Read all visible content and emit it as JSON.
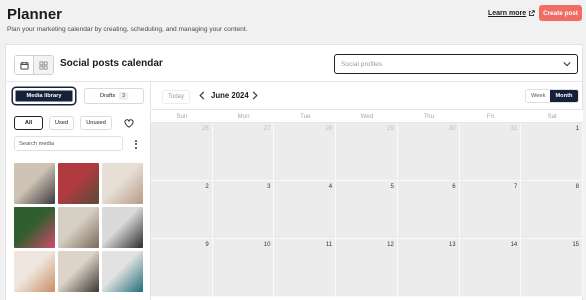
{
  "header": {
    "title": "Planner",
    "subtitle": "Plan your marketing calendar by creating, scheduling, and managing your content.",
    "learn_more": "Learn more",
    "create_post": "Create post"
  },
  "toolbar": {
    "calendar_title": "Social posts calendar",
    "profiles_placeholder": "Social profiles"
  },
  "media_panel": {
    "tab_media": "Media library",
    "tab_drafts": "Drafts",
    "drafts_count": "3",
    "filters": {
      "all": "All",
      "used": "Used",
      "unused": "Unused"
    },
    "search_placeholder": "Search media",
    "thumbnails": [
      {
        "name": "thumb-woman-laptop",
        "c1": "#cfc3b6",
        "c2": "#3a3a3a"
      },
      {
        "name": "thumb-red-hat",
        "c1": "#b13a3f",
        "c2": "#5a4a3a"
      },
      {
        "name": "thumb-coffee-flatlay",
        "c1": "#e7dfd6",
        "c2": "#b89a85"
      },
      {
        "name": "thumb-hand-flower",
        "c1": "#2f5f2f",
        "c2": "#d24a6a"
      },
      {
        "name": "thumb-dried-bouquet",
        "c1": "#d6cfc4",
        "c2": "#7b6b58"
      },
      {
        "name": "thumb-black-white-sea",
        "c1": "#dadada",
        "c2": "#2b2b2b"
      },
      {
        "name": "thumb-bottle-shelf",
        "c1": "#efe7df",
        "c2": "#c98d63"
      },
      {
        "name": "thumb-person-walking",
        "c1": "#ddd3c8",
        "c2": "#3a3632"
      },
      {
        "name": "thumb-teal-bag",
        "c1": "#e2e2e2",
        "c2": "#1f6f7a"
      }
    ]
  },
  "calendar": {
    "today": "Today",
    "month_label": "June 2024",
    "view_week": "Week",
    "view_month": "Month",
    "weekdays": [
      "Sun",
      "Mon",
      "Tue",
      "Wed",
      "Thu",
      "Fri",
      "Sat"
    ],
    "weeks": [
      [
        {
          "d": "26",
          "other": true
        },
        {
          "d": "27",
          "other": true
        },
        {
          "d": "28",
          "other": true
        },
        {
          "d": "29",
          "other": true
        },
        {
          "d": "30",
          "other": true
        },
        {
          "d": "31",
          "other": true
        },
        {
          "d": "1",
          "other": false
        }
      ],
      [
        {
          "d": "2",
          "other": false
        },
        {
          "d": "3",
          "other": false
        },
        {
          "d": "4",
          "other": false
        },
        {
          "d": "5",
          "other": false
        },
        {
          "d": "6",
          "other": false
        },
        {
          "d": "7",
          "other": false
        },
        {
          "d": "8",
          "other": false
        }
      ],
      [
        {
          "d": "9",
          "other": false
        },
        {
          "d": "10",
          "other": false
        },
        {
          "d": "11",
          "other": false
        },
        {
          "d": "12",
          "other": false
        },
        {
          "d": "13",
          "other": false
        },
        {
          "d": "14",
          "other": false
        },
        {
          "d": "15",
          "other": false
        }
      ]
    ]
  }
}
